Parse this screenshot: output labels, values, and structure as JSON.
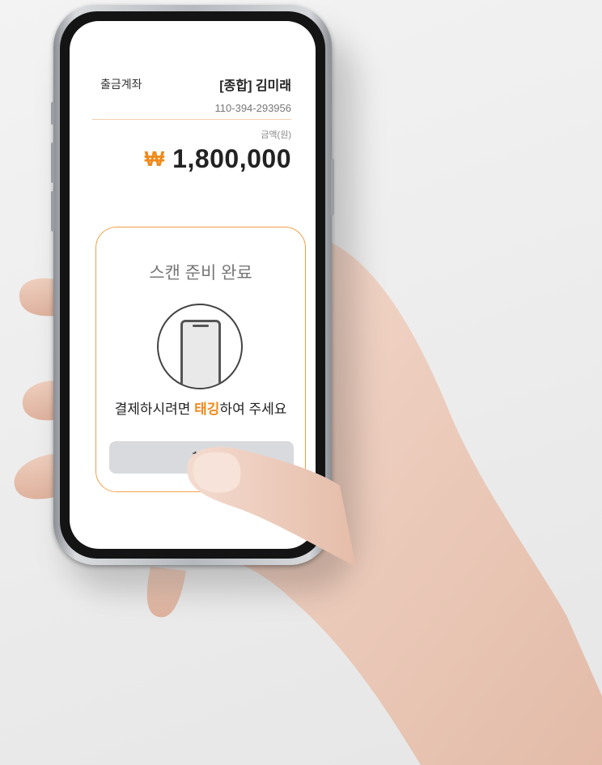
{
  "screen": {
    "account_label": "출금계좌",
    "account_name": "[종합] 김미래",
    "account_number": "110-394-293956",
    "amount_unit_label": "금액(원)",
    "currency_symbol": "₩",
    "amount": "1,800,000"
  },
  "scan_card": {
    "title": "스캔 준비 완료",
    "instruction_before": "결제하시려면 ",
    "instruction_highlight": "태깅",
    "instruction_after": "하여 주세요",
    "cancel_label": "취소"
  },
  "colors": {
    "accent": "#f08a1c",
    "card_border": "#f0a04a",
    "button_bg": "#d9dadd"
  }
}
